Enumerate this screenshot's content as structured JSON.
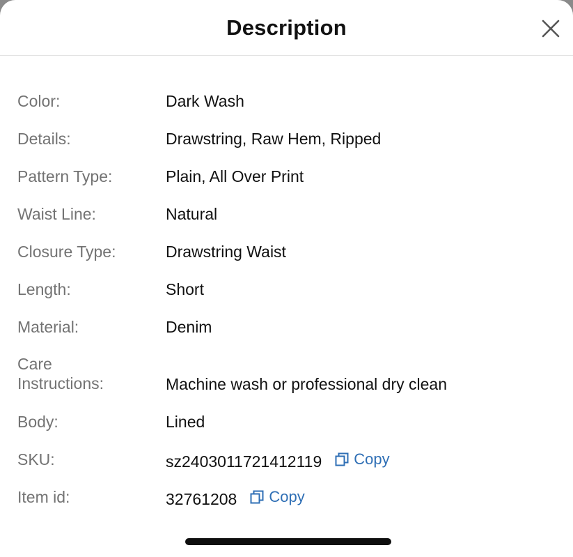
{
  "header": {
    "title": "Description",
    "close_icon": "close-icon"
  },
  "attributes": [
    {
      "label": "Color:",
      "value": "Dark Wash"
    },
    {
      "label": "Details:",
      "value": "Drawstring, Raw Hem, Ripped"
    },
    {
      "label": "Pattern Type:",
      "value": "Plain, All Over Print"
    },
    {
      "label": "Waist Line:",
      "value": "Natural"
    },
    {
      "label": "Closure Type:",
      "value": "Drawstring Waist"
    },
    {
      "label": "Length:",
      "value": "Short"
    },
    {
      "label": "Material:",
      "value": "Denim"
    },
    {
      "label": "Care\nInstructions:",
      "value": "Machine wash or professional dry clean"
    },
    {
      "label": "Body:",
      "value": "Lined"
    },
    {
      "label": "SKU:",
      "value": "sz2403011721412119",
      "copy_label": "Copy"
    },
    {
      "label": "Item id:",
      "value": "32761208",
      "copy_label": "Copy"
    }
  ],
  "colors": {
    "label": "#737373",
    "value": "#111111",
    "link": "#2f6fb5"
  },
  "icons": {
    "copy": "copy-icon"
  }
}
